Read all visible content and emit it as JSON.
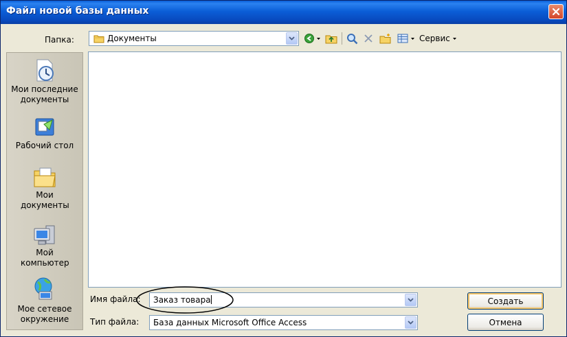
{
  "window": {
    "title": "Файл новой базы данных",
    "close_icon": "close-icon"
  },
  "folder": {
    "label": "Папка:",
    "value": "Документы",
    "icon": "folder-icon"
  },
  "toolbar": {
    "back_icon": "back-icon",
    "up_icon": "up-folder-icon",
    "search_icon": "search-web-icon",
    "delete_icon": "delete-icon",
    "new_folder_icon": "new-folder-icon",
    "views_icon": "views-icon",
    "service_label": "Сервис"
  },
  "places": [
    {
      "label": "Мои последние документы",
      "icon": "recent-documents-icon"
    },
    {
      "label": "Рабочий стол",
      "icon": "desktop-icon"
    },
    {
      "label": "Мои документы",
      "icon": "my-documents-icon"
    },
    {
      "label": "Мой компьютер",
      "icon": "my-computer-icon"
    },
    {
      "label": "Мое сетевое окружение",
      "icon": "network-places-icon"
    }
  ],
  "filename": {
    "label": "Имя файла:",
    "value": "Заказ товара"
  },
  "filetype": {
    "label": "Тип файла:",
    "value": "База данных Microsoft Office Access"
  },
  "buttons": {
    "create": "Создать",
    "cancel": "Отмена"
  },
  "colors": {
    "titlebar": "#0b5ed7",
    "dialog_bg": "#ece9d8",
    "close_button": "#d4462a"
  }
}
